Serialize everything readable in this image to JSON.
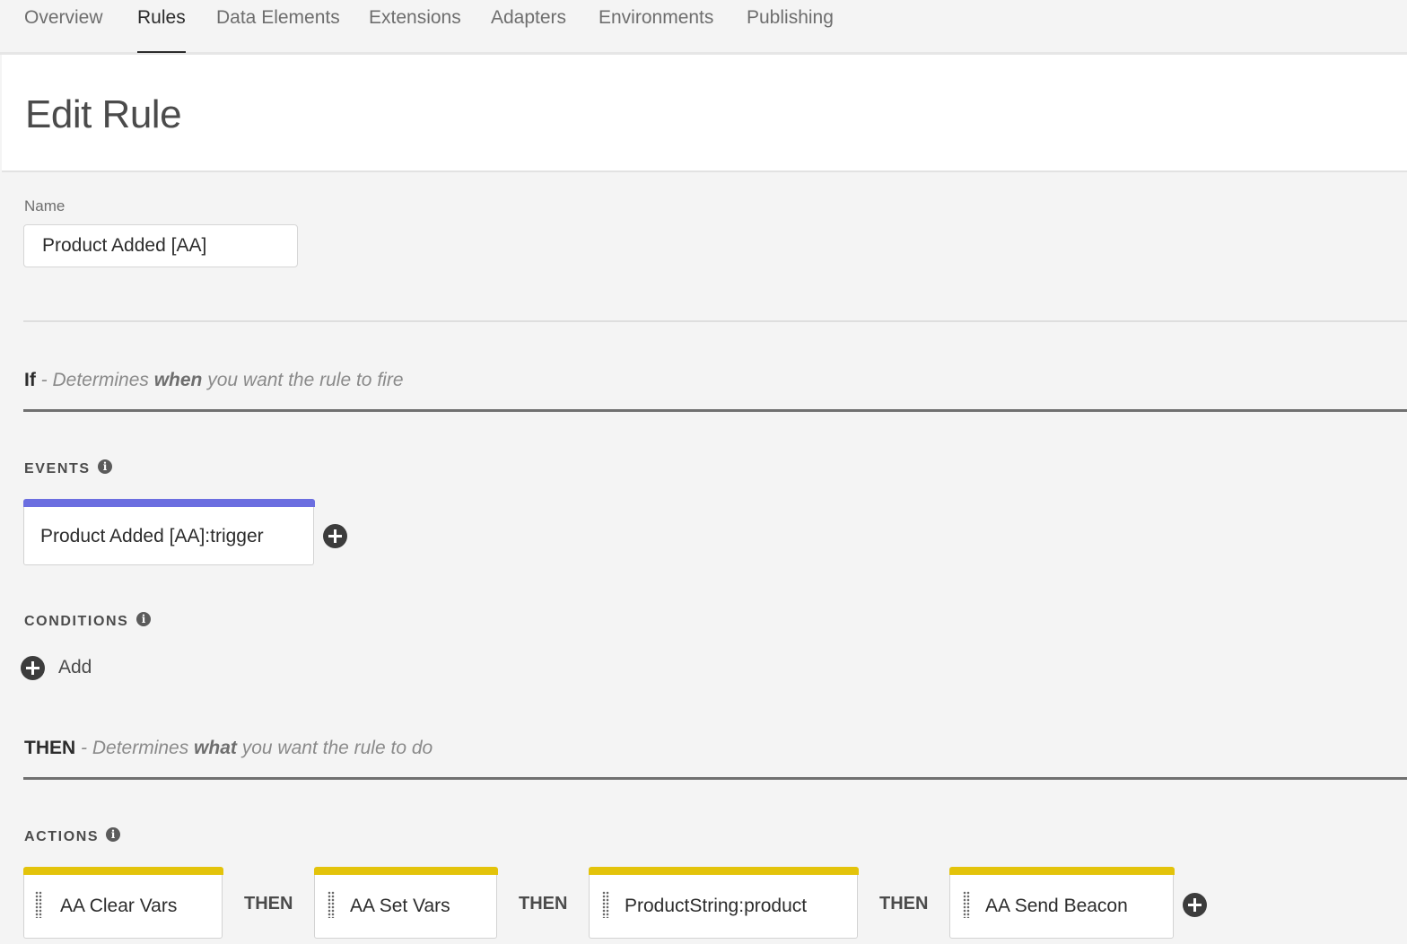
{
  "tabs": [
    {
      "label": "Overview"
    },
    {
      "label": "Rules"
    },
    {
      "label": "Data Elements"
    },
    {
      "label": "Extensions"
    },
    {
      "label": "Adapters"
    },
    {
      "label": "Environments"
    },
    {
      "label": "Publishing"
    }
  ],
  "active_tab": "Rules",
  "page_title": "Edit Rule",
  "name_field": {
    "label": "Name",
    "value": "Product Added [AA]"
  },
  "if_section": {
    "keyword": "If",
    "dash": " - ",
    "desc_before": "Determines ",
    "desc_bold": "when",
    "desc_after": " you want the rule to fire"
  },
  "events": {
    "label": "EVENTS",
    "items": [
      {
        "label": "Product Added [AA]:trigger"
      }
    ],
    "bar_color": "#6b6ee0"
  },
  "conditions": {
    "label": "CONDITIONS",
    "add_label": "Add"
  },
  "then_section": {
    "keyword": "THEN",
    "dash": " - ",
    "desc_before": "Determines ",
    "desc_bold": "what",
    "desc_after": " you want the rule to do"
  },
  "actions": {
    "label": "ACTIONS",
    "joiner": "THEN",
    "bar_color": "#e3c30a",
    "items": [
      {
        "label": "AA Clear Vars"
      },
      {
        "label": "AA Set Vars"
      },
      {
        "label": "ProductString:product"
      },
      {
        "label": "AA Send Beacon"
      }
    ]
  },
  "icons": {
    "info": "info-icon",
    "add": "plus-circle-icon",
    "drag": "drag-handle-icon"
  }
}
